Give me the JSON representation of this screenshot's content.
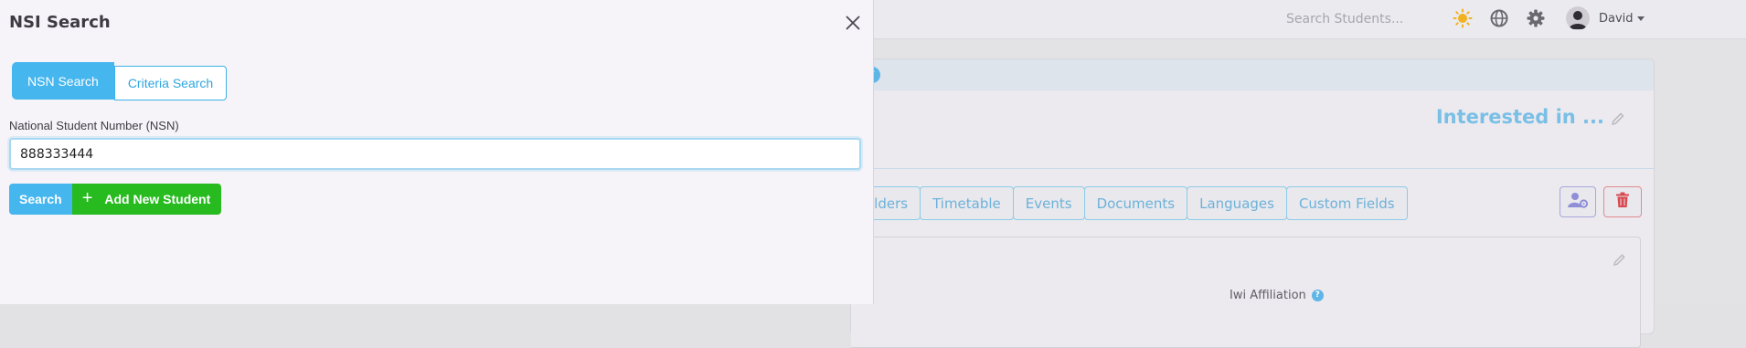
{
  "drawer": {
    "title": "NSI Search",
    "tabs": [
      {
        "label": "NSN Search",
        "active": true
      },
      {
        "label": "Criteria Search",
        "active": false
      }
    ],
    "nsn_field": {
      "label": "National Student Number (NSN)",
      "value": "888333444"
    },
    "buttons": {
      "search": "Search",
      "add_new": "Add New Student"
    }
  },
  "background": {
    "topbar": {
      "search_placeholder": "Search Students...",
      "user_name": "David",
      "icons": [
        "sun-icon",
        "globe-icon",
        "gear-icon",
        "avatar"
      ]
    },
    "record_title": "Interested in ...",
    "tabs": [
      {
        "label": "olders"
      },
      {
        "label": "Timetable"
      },
      {
        "label": "Events"
      },
      {
        "label": "Documents"
      },
      {
        "label": "Languages"
      },
      {
        "label": "Custom Fields"
      }
    ],
    "field_label": "Iwi Affiliation",
    "help_mark": "?"
  },
  "colors": {
    "primary": "#46b6ee",
    "success": "#27bb1f",
    "danger": "#d9534f"
  }
}
